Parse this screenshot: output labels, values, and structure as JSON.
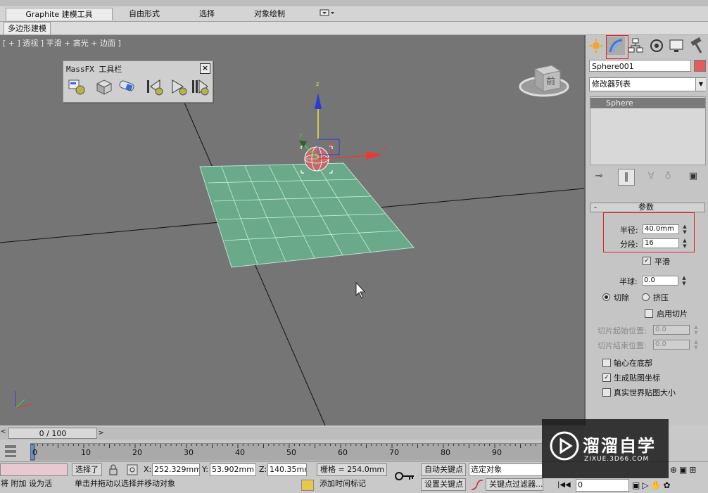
{
  "ribbon": {
    "tabs": [
      "Graphite 建模工具",
      "自由形式",
      "选择",
      "对象绘制"
    ],
    "subtab": "多边形建模"
  },
  "viewport": {
    "label": "[ + ] 透视 ] 平滑 + 高光 + 边面 ]",
    "viewcube_face": "前"
  },
  "massfx": {
    "title": "MassFX 工具栏",
    "close": "×"
  },
  "command_panel": {
    "object_name": "Sphere001",
    "object_color": "#e25d5d",
    "modifier_list": "修改器列表",
    "stack_item": "Sphere",
    "params": {
      "rollout_toggle": "-",
      "rollout_title": "参数",
      "radius_label": "半径:",
      "radius_value": "40.0mm",
      "segments_label": "分段:",
      "segments_value": "16",
      "smooth_label": "平滑",
      "hemisphere_label": "半球:",
      "hemisphere_value": "0.0",
      "chop_label": "切除",
      "squash_label": "挤压",
      "enable_slice_label": "启用切片",
      "slice_from_label": "切片起始位置:",
      "slice_from_value": "0.0",
      "slice_to_label": "切片结束位置:",
      "slice_to_value": "0.0",
      "base_to_pivot_label": "轴心在底部",
      "gen_mapping_label": "生成贴图坐标",
      "real_world_label": "真实世界贴图大小",
      "check_mark": "✓"
    }
  },
  "timeline": {
    "frame": "0 / 100",
    "ticks": [
      "0",
      "10",
      "20",
      "30",
      "40",
      "50",
      "60",
      "70",
      "80",
      "90"
    ],
    "prev": "<",
    "next": ">"
  },
  "status": {
    "selected": "选择了",
    "x_label": "X:",
    "x_value": "252.329mm",
    "y_label": "Y:",
    "y_value": "53.902mm",
    "z_label": "Z:",
    "z_value": "140.35mm",
    "grid": "栅格 = 254.0mm",
    "auto_key": "自动关键点",
    "set_key": "设置关键点",
    "selection_set": "选定对象",
    "key_filters": "关键点过滤器...",
    "frame_field": "0",
    "add_time_tag": "添加时间标记",
    "prompt": "单击并拖动以选择并移动对象",
    "left_text": "将 附加 设为活"
  },
  "watermark": {
    "main": "溜溜自学",
    "sub": "ZIXUE.3D66.COM"
  }
}
